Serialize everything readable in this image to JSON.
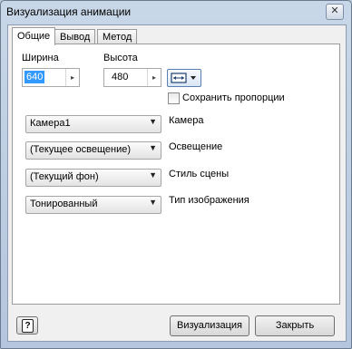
{
  "window": {
    "title": "Визуализация анимации",
    "close_glyph": "✕"
  },
  "tabs": [
    {
      "label": "Общие",
      "active": true
    },
    {
      "label": "Вывод",
      "active": false
    },
    {
      "label": "Метод",
      "active": false
    }
  ],
  "size": {
    "width_label": "Ширина",
    "width_value": "640",
    "height_label": "Высота",
    "height_value": "480",
    "keep_proportions_label": "Сохранить пропорции",
    "keep_proportions_checked": false
  },
  "settings": [
    {
      "value": "Камера1",
      "label": "Камера"
    },
    {
      "value": "(Текущее освещение)",
      "label": "Освещение"
    },
    {
      "value": "(Текущий фон)",
      "label": "Стиль сцены"
    },
    {
      "value": "Тонированный",
      "label": "Тип изображения"
    }
  ],
  "buttons": {
    "help_glyph": "?",
    "render": "Визуализация",
    "close": "Закрыть"
  },
  "icons": {
    "spin_arrow": "▸",
    "dropdown_arrow": "▼",
    "fit_icon": "fit-width-icon"
  }
}
